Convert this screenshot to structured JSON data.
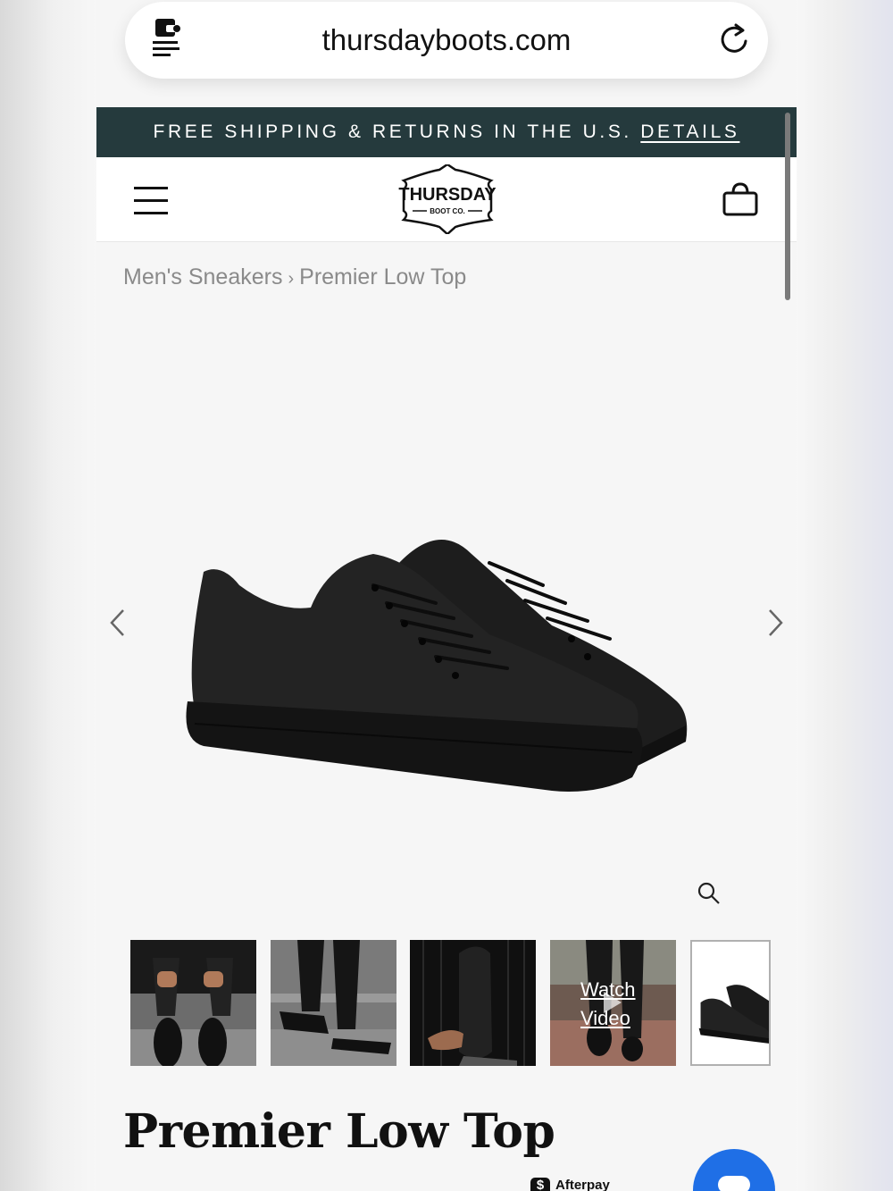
{
  "browser": {
    "url": "thursdayboots.com",
    "reader_icon": "reader-mode-icon",
    "reload_icon": "reload-icon"
  },
  "promo": {
    "text": "FREE SHIPPING & RETURNS IN THE U.S.",
    "link": "DETAILS"
  },
  "header": {
    "menu_icon": "hamburger-menu-icon",
    "logo_main": "THURSDAY",
    "logo_sub": "BOOT CO.",
    "bag_icon": "shopping-bag-icon"
  },
  "breadcrumb": {
    "parent": "Men's Sneakers",
    "separator": "›",
    "current": "Premier Low Top"
  },
  "gallery": {
    "prev_icon": "chevron-left-icon",
    "next_icon": "chevron-right-icon",
    "zoom_icon": "zoom-icon",
    "thumbnails": [
      {
        "subject": "lacing-sneakers-on-stairs"
      },
      {
        "subject": "walking-on-stairs"
      },
      {
        "subject": "holding-sneaker"
      },
      {
        "subject": "video-thumbnail",
        "watch_label": "Watch",
        "video_label": "Video"
      },
      {
        "subject": "product-shot",
        "selected": true
      }
    ]
  },
  "product": {
    "title": "Premier Low Top"
  },
  "payment": {
    "badge": "$",
    "label": "Afterpay"
  },
  "colors": {
    "promo_bg": "#253a3d",
    "chat_blue": "#1f6fe6"
  }
}
